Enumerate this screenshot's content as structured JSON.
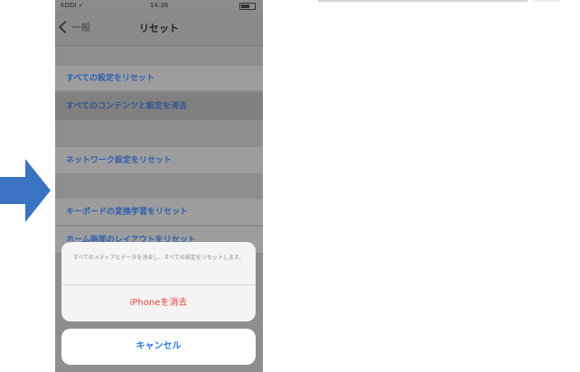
{
  "colors": {
    "arrow": "#3a73c1",
    "link_text": "#2f5fae",
    "destructive": "#e0413a",
    "cancel": "#2d7be0"
  },
  "status_bar": {
    "carrier": "KDDI ✓",
    "time": "14:38"
  },
  "nav": {
    "back_label": "一般",
    "title": "リセット"
  },
  "rows": [
    "すべての設定をリセット",
    "すべてのコンテンツと設定を消去",
    "ネットワーク設定をリセット",
    "キーボードの変換学習をリセット",
    "ホーム画面のレイアウトをリセット"
  ],
  "sheet": {
    "message": "すべてのメディアとデータを消去し、すべての設定をリセットします。",
    "destructive_label": "iPhoneを消去",
    "cancel_label": "キャンセル"
  },
  "icons": {
    "arrow": "right-arrow-icon",
    "back": "chevron-left-icon",
    "battery": "battery-icon"
  }
}
